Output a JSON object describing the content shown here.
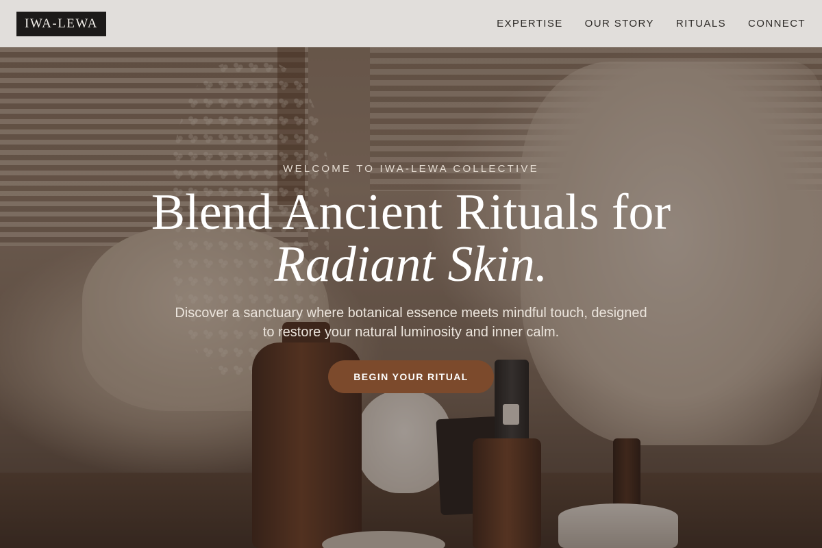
{
  "brand": {
    "logo_text": "IWA-LEWA"
  },
  "nav": {
    "items": [
      {
        "label": "EXPERTISE"
      },
      {
        "label": "OUR STORY"
      },
      {
        "label": "RITUALS"
      },
      {
        "label": "CONNECT"
      }
    ]
  },
  "hero": {
    "eyebrow": "WELCOME TO IWA-LEWA COLLECTIVE",
    "headline_line1": "Blend Ancient Rituals for",
    "headline_line2": "Radiant Skin.",
    "subtext": "Discover a sanctuary where botanical essence meets mindful touch, designed to restore your natural luminosity and inner calm.",
    "cta_label": "BEGIN YOUR RITUAL"
  },
  "colors": {
    "cta_background": "#7c4a2c",
    "logo_background": "#1c1a19",
    "navbar_background": "#e8e6e4"
  }
}
